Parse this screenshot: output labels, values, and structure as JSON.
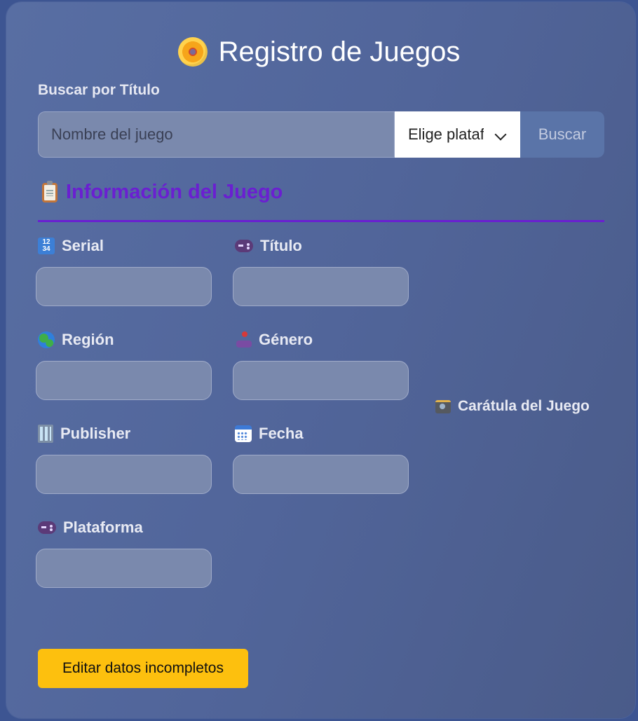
{
  "header": {
    "title": "Registro de Juegos",
    "icon": "disc-icon"
  },
  "search": {
    "label": "Buscar por Título",
    "placeholder": "Nombre del juego",
    "platform_select": "Elige plataforma",
    "button": "Buscar"
  },
  "section": {
    "title": "Información del Juego",
    "icon": "clipboard-icon",
    "accent": "#6a1fd1"
  },
  "fields": {
    "serial": {
      "label": "Serial",
      "icon": "numbers-icon"
    },
    "titulo": {
      "label": "Título",
      "icon": "gamepad-icon"
    },
    "region": {
      "label": "Región",
      "icon": "globe-icon"
    },
    "genero": {
      "label": "Género",
      "icon": "joystick-icon"
    },
    "publisher": {
      "label": "Publisher",
      "icon": "building-icon"
    },
    "fecha": {
      "label": "Fecha",
      "icon": "calendar-icon"
    },
    "plataforma": {
      "label": "Plataforma",
      "icon": "gamepad-icon"
    }
  },
  "cover": {
    "label": "Carátula del Juego",
    "icon": "camera-icon"
  },
  "actions": {
    "edit_incomplete": "Editar datos incompletos",
    "edit_color": "#fdc00e"
  }
}
